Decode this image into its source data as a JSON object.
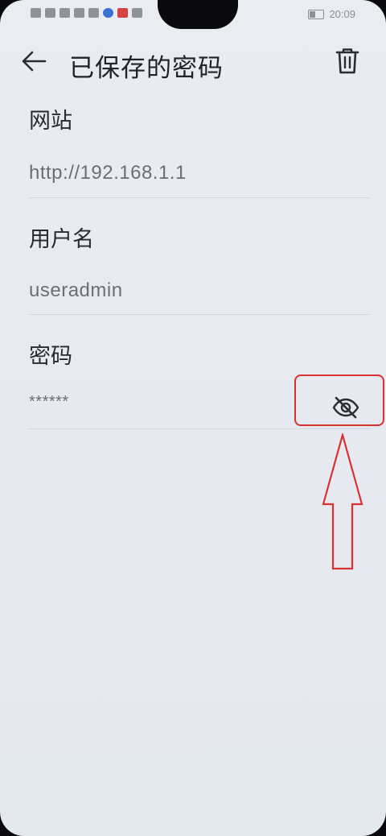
{
  "status_bar": {
    "time": "20:09"
  },
  "header": {
    "title": "已保存的密码",
    "back_icon": "arrow-left-icon",
    "delete_icon": "trash-icon"
  },
  "fields": {
    "website_label": "网站",
    "website_value": "http://192.168.1.1",
    "username_label": "用户名",
    "username_value": "useradmin",
    "password_label": "密码",
    "password_value": "******",
    "visibility_icon": "eye-off-icon"
  },
  "annotation": {
    "color": "#d93030"
  }
}
